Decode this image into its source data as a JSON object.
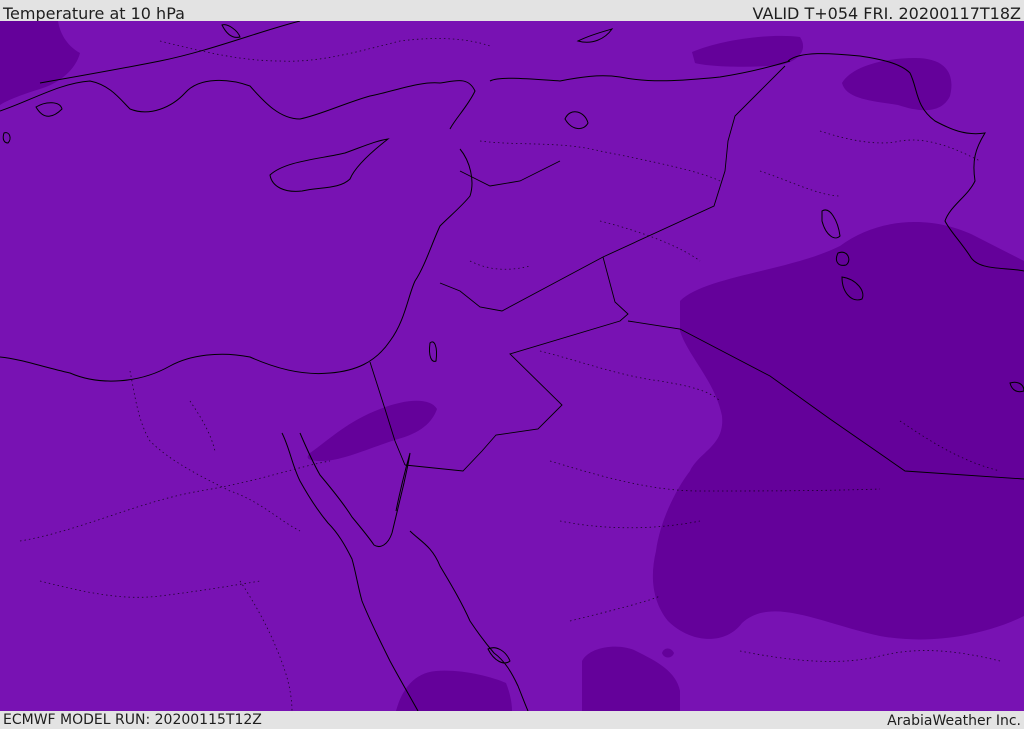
{
  "header": {
    "title": "Temperature at 10 hPa",
    "valid_label": "VALID T+054 FRI. 20200117T18Z"
  },
  "footer": {
    "model_run": "ECMWF MODEL RUN: 20200115T12Z",
    "credit": "ArabiaWeather Inc."
  },
  "map": {
    "base_fill_color": "#7812b3",
    "cold_fill_color": "#64019a",
    "coastline_color": "#000000"
  }
}
